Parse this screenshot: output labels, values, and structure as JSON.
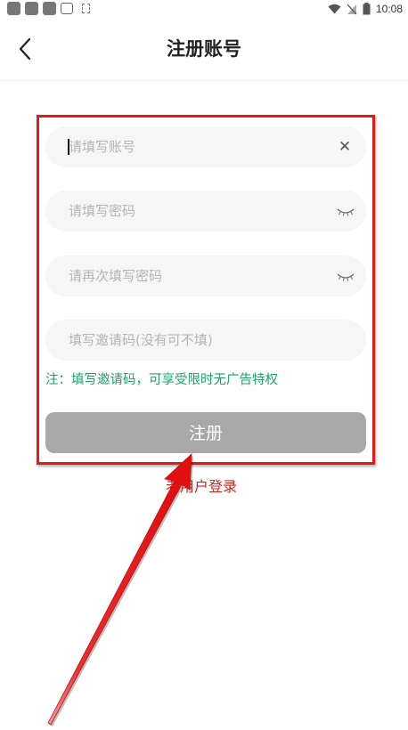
{
  "status_bar": {
    "time": "10:08"
  },
  "header": {
    "title": "注册账号"
  },
  "form": {
    "account_placeholder": "请填写账号",
    "password_placeholder": "请填写密码",
    "confirm_password_placeholder": "请再次填写密码",
    "invite_placeholder": "填写邀请码(没有可不填)",
    "note": "注：填写邀请码，可享受限时无广告特权",
    "register_label": "注册"
  },
  "footer": {
    "login_link": "老用户登录"
  },
  "colors": {
    "note_green": "#1aa36b",
    "button_gray": "#a8a8a8",
    "annotation_red": "#e01b1b",
    "link_red": "#d0231f"
  },
  "icons": {
    "back": "chevron-left-icon",
    "clear": "close-icon",
    "eye": "eye-closed-icon"
  }
}
